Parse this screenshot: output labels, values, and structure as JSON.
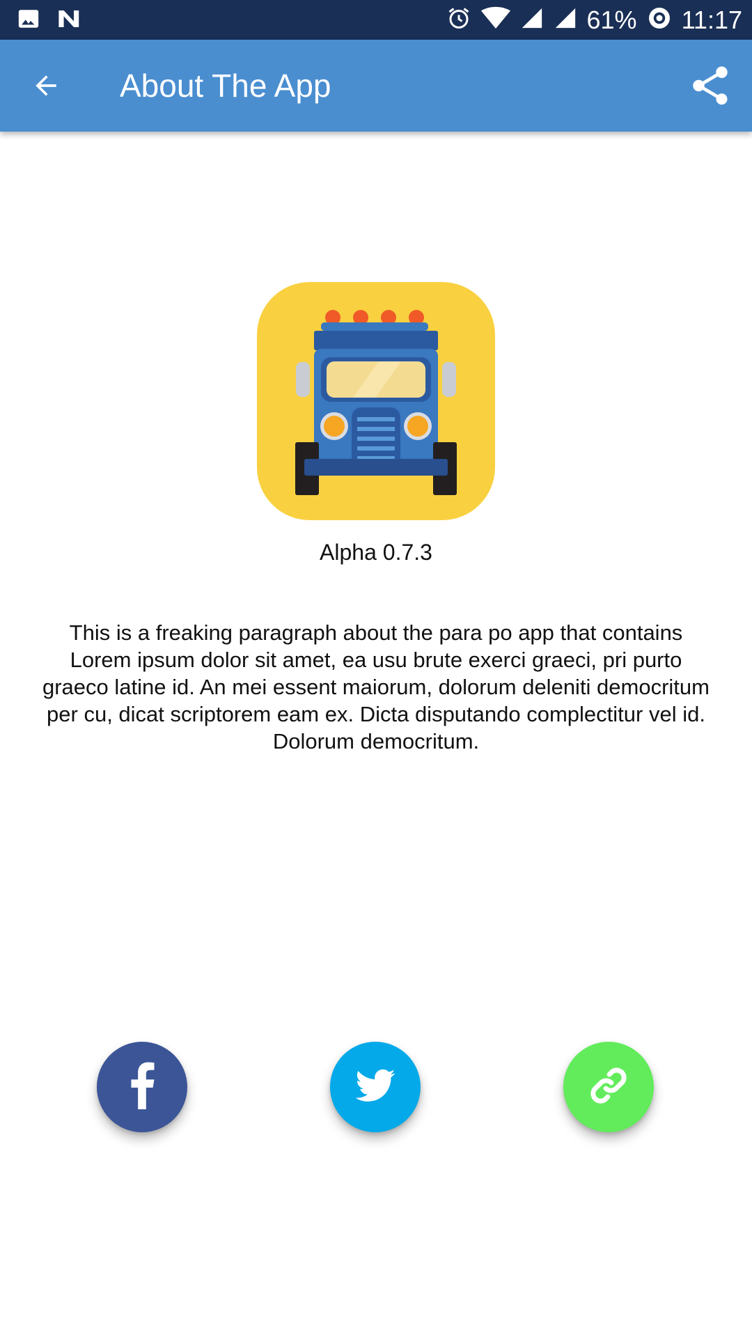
{
  "status_bar": {
    "battery_percent": "61%",
    "time": "11:17",
    "icons": [
      "image-icon",
      "n-app-icon",
      "alarm-icon",
      "wifi-icon",
      "signal-icon",
      "signal-icon",
      "sync-icon"
    ]
  },
  "app_bar": {
    "title": "About The App",
    "back_icon": "arrow-back-icon",
    "share_icon": "share-icon",
    "color": "#4a8ed0"
  },
  "logo": {
    "icon": "jeepney-icon",
    "background": "#f9d03f"
  },
  "version": "Alpha 0.7.3",
  "description": "This is a freaking paragraph about the para po app that contains Lorem ipsum dolor sit amet, ea usu brute exerci graeci, pri purto graeco latine id. An mei essent maiorum, dolorum deleniti democritum per cu, dicat scriptorem eam ex. Dicta disputando complectitur vel id. Dolorum democritum.",
  "social_buttons": [
    {
      "icon": "facebook-icon",
      "color": "#3b5597"
    },
    {
      "icon": "twitter-icon",
      "color": "#03a9e9"
    },
    {
      "icon": "link-icon",
      "color": "#62ec5b"
    }
  ]
}
